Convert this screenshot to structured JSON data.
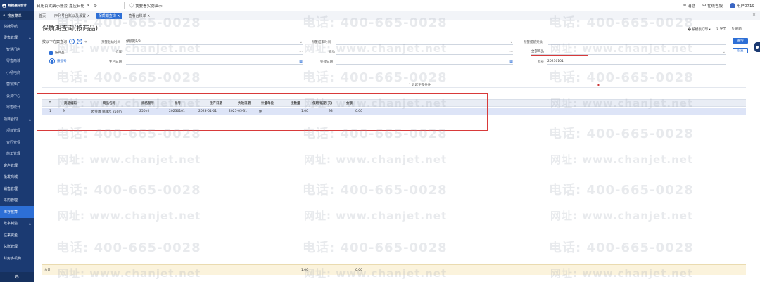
{
  "topbar": {
    "logo_text": "畅捷通好会计",
    "logo_sub": "专业版",
    "org_name": "日用百货演示账套-嘉应日化",
    "demo_link": "我要看实例演示",
    "right": [
      "消息",
      "在线客服",
      "用户0719"
    ]
  },
  "sidebar": {
    "search": "搜索菜单",
    "items": [
      {
        "label": "快捷导航",
        "sub": false,
        "active": false,
        "arrow": false
      },
      {
        "label": "零售管理",
        "sub": false,
        "active": false,
        "arrow": true
      },
      {
        "label": "智慧门店",
        "sub": true,
        "active": false,
        "arrow": false
      },
      {
        "label": "零售商城",
        "sub": true,
        "active": false,
        "arrow": false
      },
      {
        "label": "小畅电商",
        "sub": true,
        "active": false,
        "arrow": false
      },
      {
        "label": "营销推广",
        "sub": true,
        "active": false,
        "arrow": false
      },
      {
        "label": "会员中心",
        "sub": true,
        "active": false,
        "arrow": false
      },
      {
        "label": "零售统计",
        "sub": true,
        "active": false,
        "arrow": false
      },
      {
        "label": "项目合同",
        "sub": false,
        "active": false,
        "arrow": true
      },
      {
        "label": "项目管理",
        "sub": true,
        "active": false,
        "arrow": false
      },
      {
        "label": "合同管理",
        "sub": true,
        "active": false,
        "arrow": false
      },
      {
        "label": "施工管理",
        "sub": true,
        "active": false,
        "arrow": false
      },
      {
        "label": "客户管理",
        "sub": false,
        "active": false,
        "arrow": false
      },
      {
        "label": "批发商城",
        "sub": false,
        "active": false,
        "arrow": false
      },
      {
        "label": "销售管理",
        "sub": false,
        "active": false,
        "arrow": false
      },
      {
        "label": "采购管理",
        "sub": false,
        "active": false,
        "arrow": false
      },
      {
        "label": "库存核算",
        "sub": false,
        "active": true,
        "arrow": false
      },
      {
        "label": "数字制造",
        "sub": false,
        "active": false,
        "arrow": true
      },
      {
        "label": "往来资金",
        "sub": false,
        "active": false,
        "arrow": false
      },
      {
        "label": "总账管理",
        "sub": false,
        "active": false,
        "arrow": false
      },
      {
        "label": "财务多机构",
        "sub": false,
        "active": false,
        "arrow": false
      }
    ]
  },
  "tabs": [
    {
      "label": "首页",
      "active": false
    },
    {
      "label": "序列号台账以及设置 ×",
      "active": false
    },
    {
      "label": "保质期查询 ×",
      "active": true
    },
    {
      "label": "查看台账单 ×",
      "active": false
    }
  ],
  "page": {
    "title": "保质期查询(按商品)",
    "actions": [
      "按模板打印",
      "导出",
      "刷新"
    ]
  },
  "filters": {
    "hint": "按以下方案查询",
    "opt_goods": "按商品",
    "opt_batch": "按批号",
    "start_label": "预警起始时间",
    "start_value": "保质期1/3",
    "end_label": "预警结束时间",
    "end_value": "",
    "days_label": "预警提前天数",
    "days_value": "",
    "warehouse_label": "仓库",
    "goods_label": "商品",
    "all_label": "全部商品",
    "prod_date_label": "生产日期",
    "expire_date_label": "失效日期",
    "batch_label": "批号",
    "batch_value": "20230101",
    "query_btn": "查询",
    "settings_btn": "设置",
    "collapse": "收起更多条件"
  },
  "table": {
    "headers": [
      "商品编码",
      "商品名称",
      "规格型号",
      "批号",
      "生产日期",
      "失效日期",
      "计量单位",
      "主数量",
      "保期/临期(天)",
      "金额"
    ],
    "rows": [
      [
        "1",
        "9",
        "欧莱雅 爽肤水 250ml",
        "250ml",
        "20230101",
        "2023-01-01",
        "2025-05-31",
        "件",
        "1.00",
        "93",
        "0.00"
      ]
    ],
    "footer": {
      "label": "合计",
      "qty": "1.00",
      "amount": "0.00"
    }
  },
  "watermark": {
    "phone": "电话: 400-665-0028",
    "site": "网址: www.chanjet.net"
  }
}
